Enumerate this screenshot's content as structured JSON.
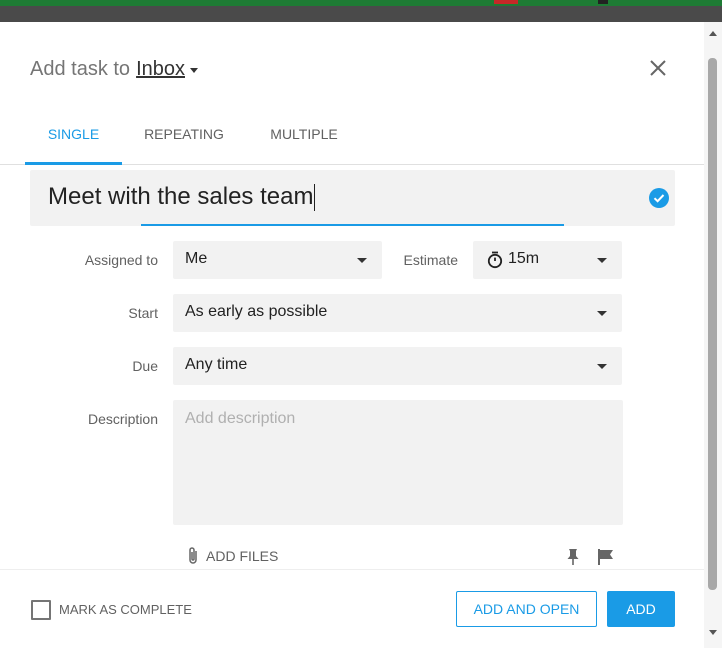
{
  "header": {
    "prefix": "Add task to",
    "project": "Inbox"
  },
  "tabs": [
    {
      "label": "SINGLE",
      "active": true
    },
    {
      "label": "REPEATING",
      "active": false
    },
    {
      "label": "MULTIPLE",
      "active": false
    }
  ],
  "task": {
    "title": "Meet with the sales team"
  },
  "form": {
    "assigned_label": "Assigned to",
    "assigned_value": "Me",
    "estimate_label": "Estimate",
    "estimate_value": "15m",
    "start_label": "Start",
    "start_value": "As early as possible",
    "due_label": "Due",
    "due_value": "Any time",
    "description_label": "Description",
    "description_placeholder": "Add description",
    "add_files_label": "ADD FILES"
  },
  "footer": {
    "mark_complete_label": "MARK AS COMPLETE",
    "add_and_open_label": "ADD AND OPEN",
    "add_label": "ADD"
  },
  "colors": {
    "accent": "#1a9be6",
    "field_bg": "#f2f2f2"
  }
}
